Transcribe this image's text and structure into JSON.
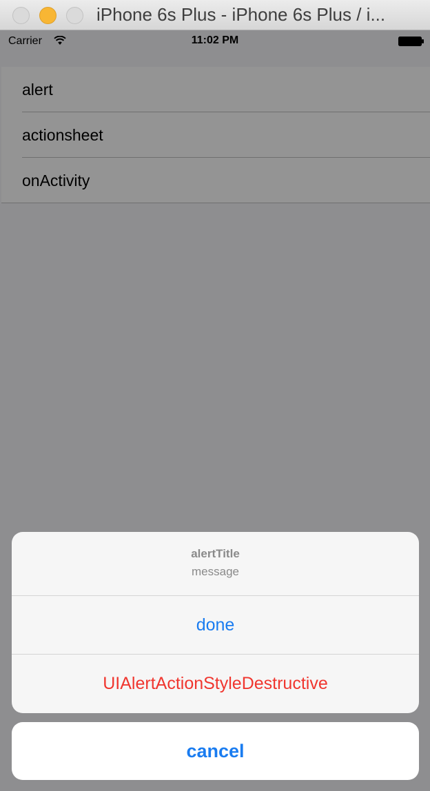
{
  "window": {
    "title": "iPhone 6s Plus - iPhone 6s Plus / i..."
  },
  "statusbar": {
    "carrier": "Carrier",
    "time": "11:02 PM",
    "wifi_icon": "wifi-icon",
    "battery_icon": "battery-icon"
  },
  "list": {
    "items": [
      {
        "label": "alert"
      },
      {
        "label": "actionsheet"
      },
      {
        "label": "onActivity"
      }
    ]
  },
  "action_sheet": {
    "title": "alertTitle",
    "message": "message",
    "actions": [
      {
        "label": "done",
        "style": "default",
        "color": "#1a7cf0"
      },
      {
        "label": "UIAlertActionStyleDestructive",
        "style": "destructive",
        "color": "#f0362f"
      }
    ],
    "cancel_label": "cancel"
  },
  "colors": {
    "accent": "#1a7cf0",
    "destructive": "#f0362f",
    "dim_background": "#8e8e90"
  }
}
